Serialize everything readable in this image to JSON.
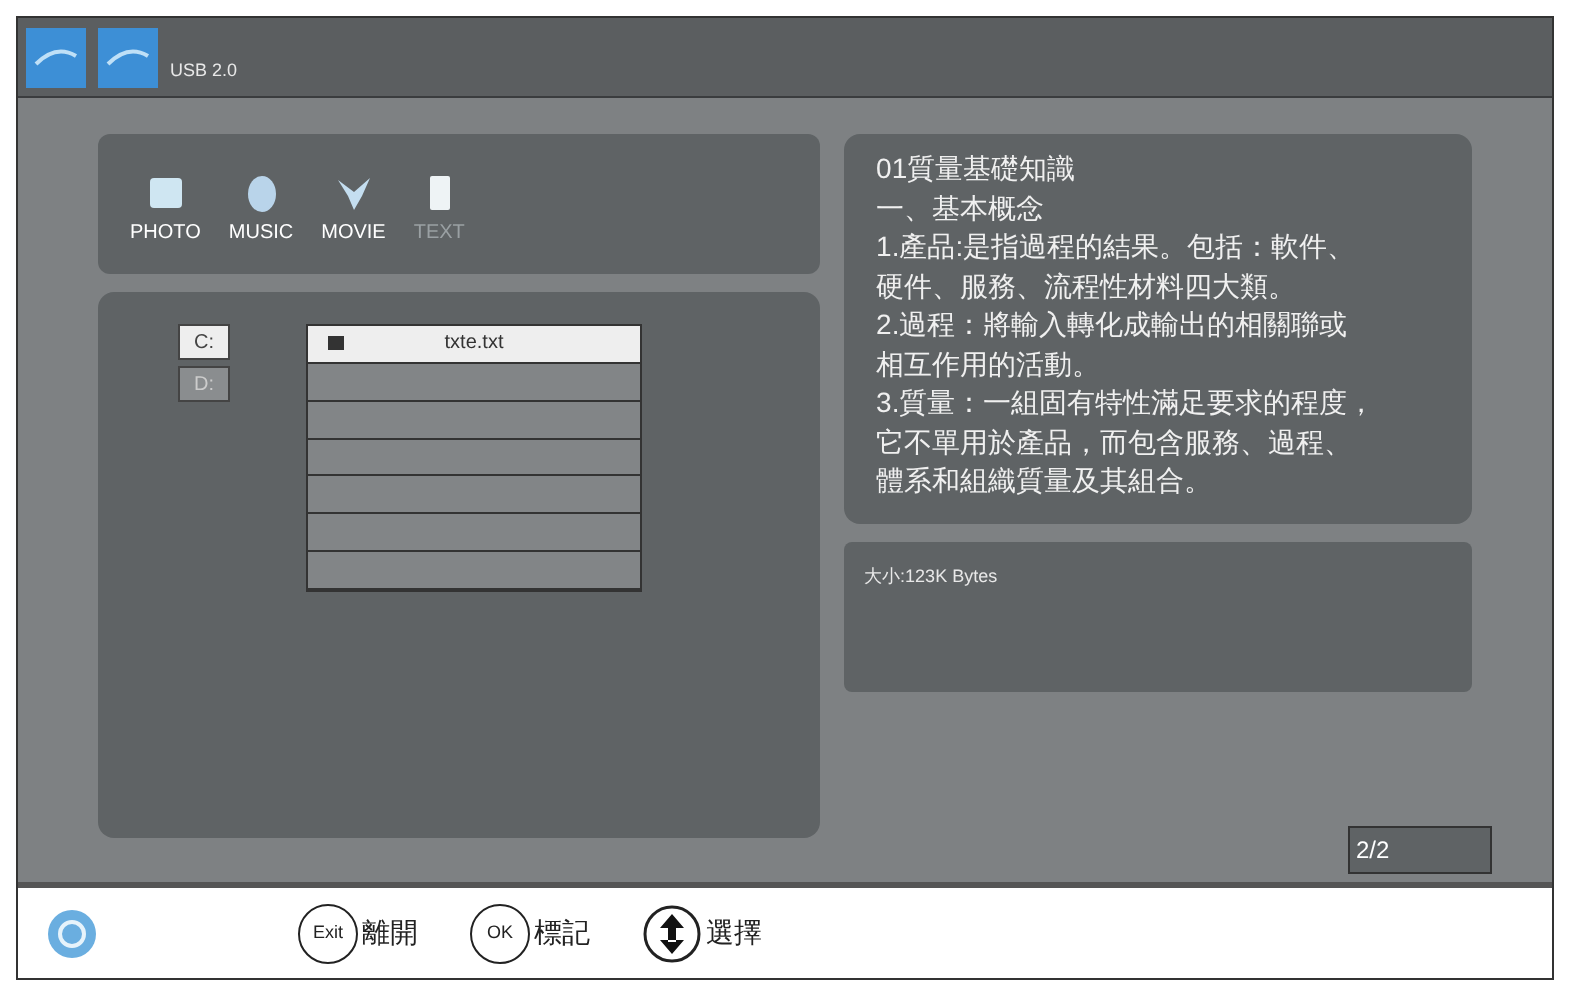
{
  "top_bar": {
    "label": "USB 2.0"
  },
  "media_tabs": [
    {
      "label": "PHOTO",
      "selected": false
    },
    {
      "label": "MUSIC",
      "selected": false
    },
    {
      "label": "MOVIE",
      "selected": false
    },
    {
      "label": "TEXT",
      "selected": true
    }
  ],
  "drives": [
    {
      "label": "C:",
      "selected": true
    },
    {
      "label": "D:",
      "selected": false
    }
  ],
  "files": [
    {
      "name": "txte.txt",
      "selected": true
    }
  ],
  "text_view": {
    "lines": [
      "01質量基礎知識",
      "一、基本概念",
      "1.產品:是指過程的結果。包括：軟件、",
      "硬件、服務、流程性材料四大類。",
      "2.過程：將輸入轉化成輸出的相關聯或",
      "相互作用的活動。",
      "3.質量：一組固有特性滿足要求的程度，",
      "它不單用於產品，而包含服務、過程、",
      "體系和組織質量及其組合。"
    ]
  },
  "info": {
    "size": "大小:123K Bytes"
  },
  "page_indicator": "2/2",
  "footer": [
    {
      "kind": "key",
      "key": "Exit",
      "label": "離開"
    },
    {
      "kind": "key",
      "key": "OK",
      "label": "標記"
    },
    {
      "kind": "arrows",
      "label": "選擇"
    }
  ]
}
